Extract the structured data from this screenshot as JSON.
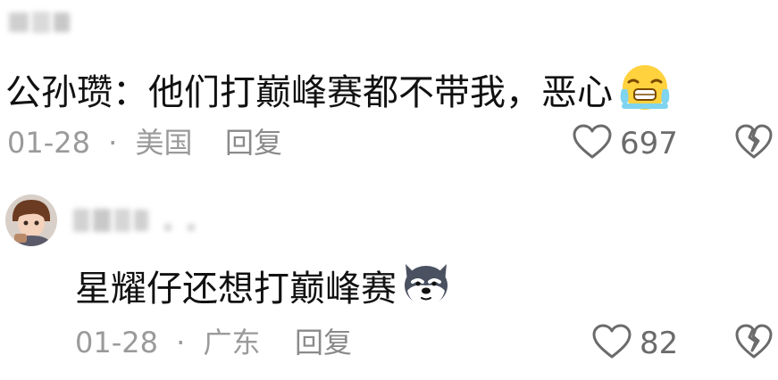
{
  "comments": [
    {
      "content": "公孙瓒：他们打巅峰赛都不带我，恶心",
      "emoji": "crying-face-emoji",
      "date": "01-28",
      "separator": "·",
      "location": "美国",
      "reply_label": "回复",
      "likes": "697"
    },
    {
      "content": "星耀仔还想打巅峰赛",
      "emoji": "dog-face-emoji",
      "date": "01-28",
      "separator": "·",
      "location": "广东",
      "reply_label": "回复",
      "likes": "82"
    }
  ],
  "icons": {
    "like": "heart-outline-icon",
    "dislike": "broken-heart-icon"
  },
  "colors": {
    "text": "#111111",
    "meta": "#9a9a9a",
    "icon": "#6b6b6b"
  }
}
